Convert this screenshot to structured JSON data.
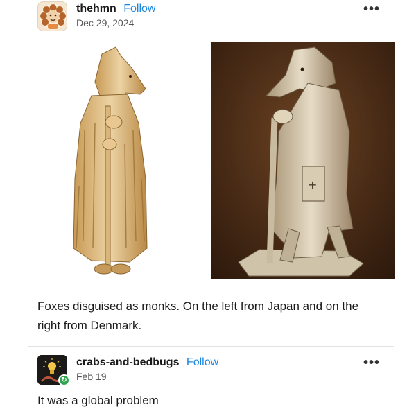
{
  "post": {
    "author": "thehmn",
    "follow_label": "Follow",
    "date": "Dec 29, 2024",
    "more_label": "•••",
    "caption": "Foxes disguised as monks. On the left from Japan and on the right from Denmark."
  },
  "reply": {
    "author": "crabs-and-bedbugs",
    "follow_label": "Follow",
    "date": "Feb 19",
    "more_label": "•••",
    "text": "It was a global problem"
  },
  "colors": {
    "follow": "#1b86e0",
    "badge": "#2ea44f"
  },
  "icons": {
    "more": "ellipsis-icon",
    "badge": "refresh-icon"
  }
}
